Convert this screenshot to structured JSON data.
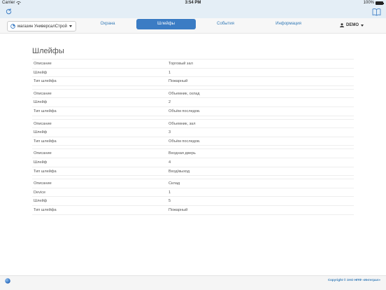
{
  "status_bar": {
    "carrier": "Carrier",
    "time": "3:54 PM",
    "battery": "100%"
  },
  "toolbar": {
    "refresh_icon": "refresh-icon",
    "book_icon": "book-icon"
  },
  "nav": {
    "store_select": "магазин УниверсалСтрой",
    "tabs": [
      "Охрана",
      "Шлейфы",
      "События",
      "Информация"
    ],
    "active_tab": "Шлейфы",
    "user": "DEMO",
    "accent": "#3b7cc4"
  },
  "main": {
    "title": "Шлейфы",
    "groups": [
      {
        "rows": [
          {
            "key": "Описание",
            "value": "Торговый зал"
          },
          {
            "key": "Шлейф",
            "value": "1"
          },
          {
            "key": "Тип шлейфа",
            "value": "Пожарный"
          }
        ]
      },
      {
        "rows": [
          {
            "key": "Описание",
            "value": "Объемник, склад"
          },
          {
            "key": "Шлейф",
            "value": "2"
          },
          {
            "key": "Тип шлейфа",
            "value": "Объём последов."
          }
        ]
      },
      {
        "rows": [
          {
            "key": "Описание",
            "value": "Объемник, зал"
          },
          {
            "key": "Шлейф",
            "value": "3"
          },
          {
            "key": "Тип шлейфа",
            "value": "Объём последов."
          }
        ]
      },
      {
        "rows": [
          {
            "key": "Описание",
            "value": "Входная дверь"
          },
          {
            "key": "Шлейф",
            "value": "4"
          },
          {
            "key": "Тип шлейфа",
            "value": "Вход/выход"
          }
        ]
      },
      {
        "rows": [
          {
            "key": "Описание",
            "value": "Склад"
          },
          {
            "key": "Device",
            "value": "1"
          },
          {
            "key": "Шлейф",
            "value": "5"
          },
          {
            "key": "Тип шлейфа",
            "value": "Пожарный"
          }
        ]
      }
    ]
  },
  "footer": {
    "copyright": "Copyright © ЗАО НПФ «Интеграл»"
  }
}
